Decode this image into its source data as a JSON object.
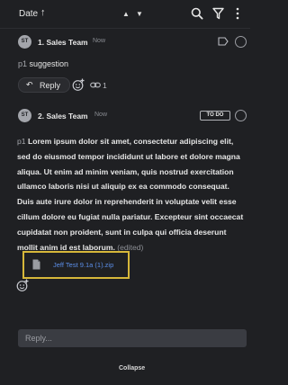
{
  "toolbar": {
    "sort_label": "Date",
    "sort_direction_icon": "arrow-up-icon",
    "icons": [
      "search-icon",
      "filter-icon",
      "more-vertical-icon"
    ]
  },
  "comment1": {
    "avatar_initials": "ST",
    "author": "1. Sales Team",
    "time": "Now",
    "prefix": "p1",
    "text": "suggestion",
    "reply_label": "Reply",
    "link_count": "1",
    "icons": [
      "tag-icon",
      "resolve-circle-icon",
      "emoji-add-icon",
      "link-icon",
      "reply-arrow-icon"
    ]
  },
  "comment2": {
    "avatar_initials": "ST",
    "author": "2. Sales Team",
    "time": "Now",
    "status_badge": "TO DO",
    "prefix": "p1",
    "text": "Lorem ipsum dolor sit amet, consectetur adipiscing elit, sed do eiusmod tempor incididunt ut labore et dolore magna aliqua. Ut enim ad minim veniam, quis nostrud exercitation ullamco laboris nisi ut aliquip ex ea commodo consequat. Duis aute irure dolor in reprehenderit in voluptate velit esse cillum dolore eu fugiat nulla pariatur. Excepteur sint occaecat cupidatat non proident, sunt in culpa qui officia deserunt mollit anim id est laborum.",
    "edited_label": "(edited)",
    "attachment_name": "Jeff Test 9.1a (1).zip",
    "reply_placeholder": "Reply...",
    "collapse_label": "Collapse"
  },
  "colors": {
    "background": "#1f2023",
    "accent_red": "#c2374a",
    "highlight_yellow": "#d6b73a",
    "link_blue": "#5b8ee8"
  }
}
